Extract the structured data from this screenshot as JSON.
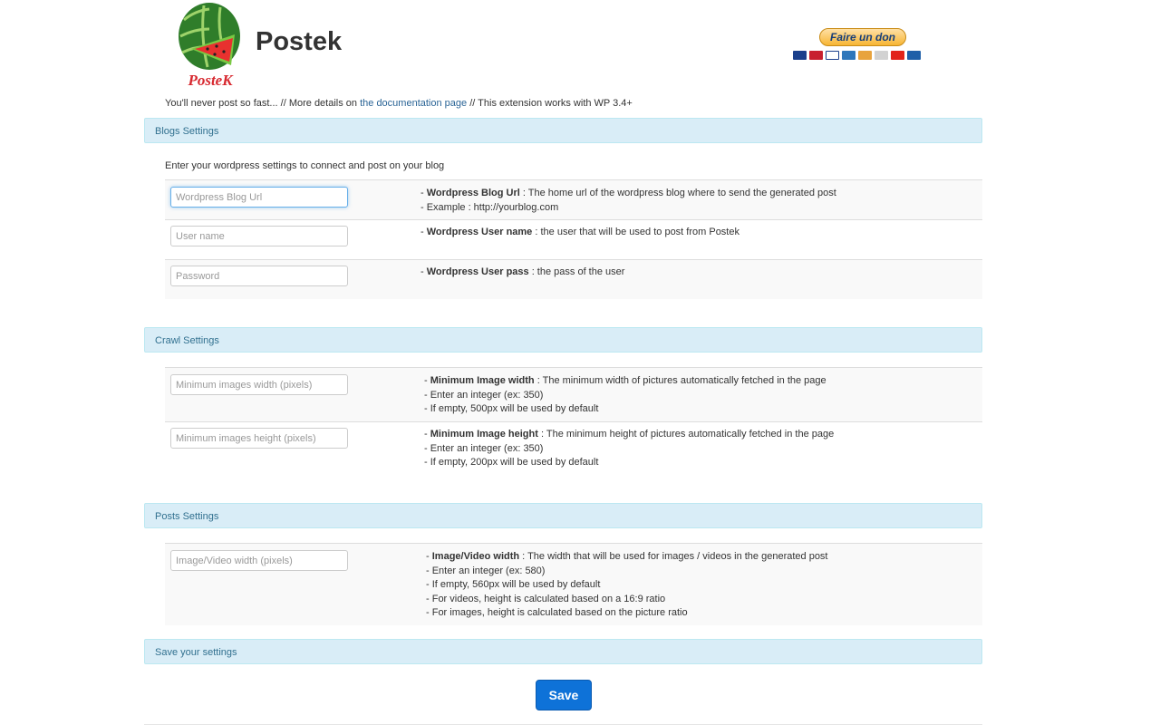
{
  "header": {
    "app_title": "Postek",
    "logo_text": "PosteK",
    "donate_label": "Faire un don"
  },
  "intro": {
    "prefix": "You'll never post so fast... // More details on ",
    "link_text": "the documentation page",
    "suffix": " // This extension works with WP 3.4+"
  },
  "blogs": {
    "title": "Blogs Settings",
    "description": "Enter your wordpress settings to connect and post on your blog",
    "rows": [
      {
        "placeholder": "Wordpress Blog Url",
        "value": "",
        "strong": "Wordpress Blog Url",
        "text": " : The home url of the wordpress blog where to send the generated post",
        "lines": [
          "- Example : http://yourblog.com"
        ]
      },
      {
        "placeholder": "User name",
        "value": "",
        "strong": "Wordpress User name",
        "text": " : the user that will be used to post from Postek",
        "lines": []
      },
      {
        "placeholder": "Password",
        "value": "",
        "strong": "Wordpress User pass",
        "text": " : the pass of the user",
        "lines": []
      }
    ]
  },
  "crawl": {
    "title": "Crawl Settings",
    "rows": [
      {
        "placeholder": "Minimum images width (pixels)",
        "value": "",
        "strong": "Minimum Image width",
        "text": " : The minimum width of pictures automatically fetched in the page",
        "lines": [
          "- Enter an integer (ex: 350)",
          "- If empty, 500px will be used by default"
        ]
      },
      {
        "placeholder": "Minimum images height (pixels)",
        "value": "",
        "strong": "Minimum Image height",
        "text": " : The minimum height of pictures automatically fetched in the page",
        "lines": [
          "- Enter an integer (ex: 350)",
          "- If empty, 200px will be used by default"
        ]
      }
    ]
  },
  "posts": {
    "title": "Posts Settings",
    "rows": [
      {
        "placeholder": "Image/Video width (pixels)",
        "value": "",
        "strong": "Image/Video width",
        "text": " : The width that will be used for images / videos in the generated post",
        "lines": [
          "- Enter an integer (ex: 580)",
          "- If empty, 560px will be used by default",
          "- For videos, height is calculated based on a 16:9 ratio",
          "- For images, height is calculated based on the picture ratio"
        ]
      }
    ]
  },
  "save": {
    "title": "Save your settings",
    "button_label": "Save"
  },
  "colors": {
    "panel_bg": "#d9edf7",
    "panel_text": "#31708f",
    "save_button": "#0e72d8",
    "link": "#2a6496"
  }
}
